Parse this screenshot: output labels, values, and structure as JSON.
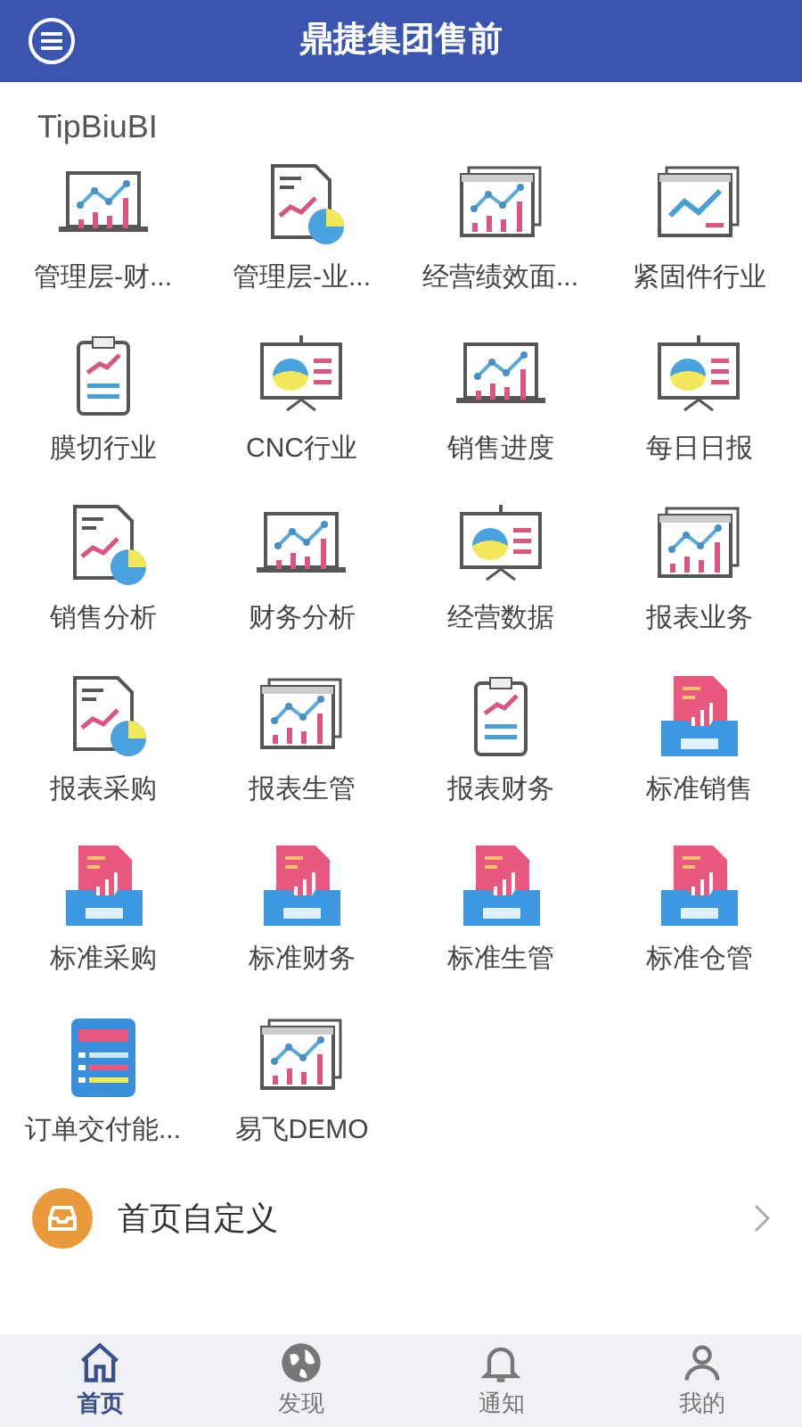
{
  "header": {
    "title": "鼎捷集团售前"
  },
  "section": {
    "title": "TipBiuBI"
  },
  "apps": [
    {
      "label": "管理层-财...",
      "kind": "laptop"
    },
    {
      "label": "管理层-业...",
      "kind": "doc"
    },
    {
      "label": "经营绩效面...",
      "kind": "windows"
    },
    {
      "label": "紧固件行业",
      "kind": "trend"
    },
    {
      "label": "膜切行业",
      "kind": "clipboard"
    },
    {
      "label": "CNC行业",
      "kind": "board"
    },
    {
      "label": "销售进度",
      "kind": "laptop"
    },
    {
      "label": "每日日报",
      "kind": "board"
    },
    {
      "label": "销售分析",
      "kind": "doc"
    },
    {
      "label": "财务分析",
      "kind": "laptop"
    },
    {
      "label": "经营数据",
      "kind": "board"
    },
    {
      "label": "报表业务",
      "kind": "windows"
    },
    {
      "label": "报表采购",
      "kind": "doc"
    },
    {
      "label": "报表生管",
      "kind": "windows"
    },
    {
      "label": "报表财务",
      "kind": "clipboard"
    },
    {
      "label": "标准销售",
      "kind": "standard"
    },
    {
      "label": "标准采购",
      "kind": "standard"
    },
    {
      "label": "标准财务",
      "kind": "standard"
    },
    {
      "label": "标准生管",
      "kind": "standard"
    },
    {
      "label": "标准仓管",
      "kind": "standard"
    },
    {
      "label": "订单交付能...",
      "kind": "order"
    },
    {
      "label": "易飞DEMO",
      "kind": "windows"
    }
  ],
  "customize": {
    "label": "首页自定义"
  },
  "tabs": [
    {
      "label": "首页",
      "kind": "home",
      "selected": true
    },
    {
      "label": "发现",
      "kind": "globe",
      "selected": false
    },
    {
      "label": "通知",
      "kind": "bell",
      "selected": false
    },
    {
      "label": "我的",
      "kind": "user",
      "selected": false
    }
  ]
}
